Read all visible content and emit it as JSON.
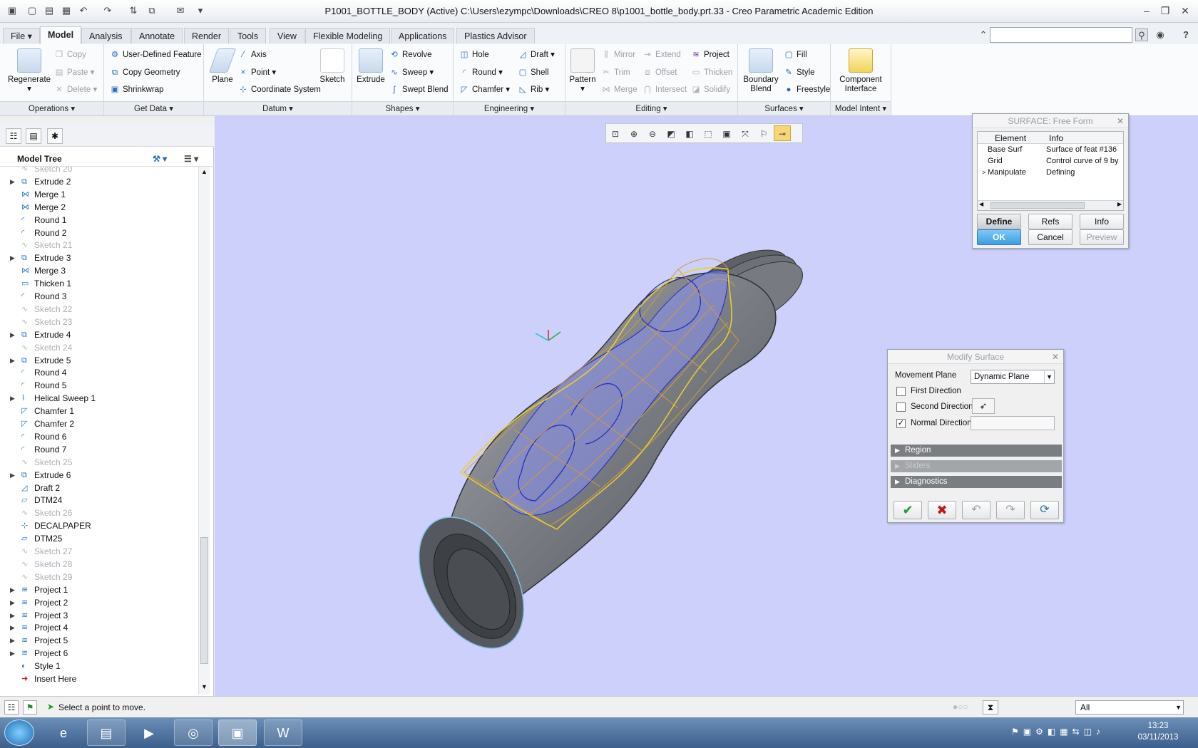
{
  "window": {
    "title": "P1001_BOTTLE_BODY (Active) C:\\Users\\ezympc\\Downloads\\CREO 8\\p1001_bottle_body.prt.33 - Creo Parametric Academic Edition"
  },
  "ribbon": {
    "tabs": [
      "File",
      "Model",
      "Analysis",
      "Annotate",
      "Render",
      "Tools",
      "View",
      "Flexible Modeling",
      "Applications",
      "Plastics Advisor"
    ],
    "active_tab": "Model",
    "groups": {
      "operations": {
        "label": "Operations",
        "regenerate": "Regenerate",
        "copy": "Copy",
        "paste": "Paste",
        "delete": "Delete"
      },
      "get_data": {
        "label": "Get Data",
        "udf": "User-Defined Feature",
        "copy_geometry": "Copy Geometry",
        "shrinkwrap": "Shrinkwrap"
      },
      "datum": {
        "label": "Datum",
        "plane": "Plane",
        "axis": "Axis",
        "point": "Point",
        "csys": "Coordinate System",
        "sketch": "Sketch"
      },
      "shapes": {
        "label": "Shapes",
        "extrude": "Extrude",
        "revolve": "Revolve",
        "sweep": "Sweep",
        "swept_blend": "Swept Blend"
      },
      "engineering": {
        "label": "Engineering",
        "hole": "Hole",
        "round": "Round",
        "chamfer": "Chamfer",
        "draft": "Draft",
        "shell": "Shell",
        "rib": "Rib"
      },
      "editing": {
        "label": "Editing",
        "pattern": "Pattern",
        "mirror": "Mirror",
        "trim": "Trim",
        "merge": "Merge",
        "extend": "Extend",
        "offset": "Offset",
        "intersect": "Intersect",
        "project": "Project",
        "thicken": "Thicken",
        "solidify": "Solidify"
      },
      "surfaces": {
        "label": "Surfaces",
        "boundary_blend": "Boundary Blend",
        "fill": "Fill",
        "style": "Style",
        "freestyle": "Freestyle"
      },
      "model_intent": {
        "label": "Model Intent",
        "component_interface": "Component Interface"
      }
    }
  },
  "model_tree": {
    "header": "Model Tree",
    "items": [
      {
        "label": "Sketch 20",
        "dim": true,
        "expandable": false,
        "icon": "sketch-icon"
      },
      {
        "label": "Extrude 2",
        "dim": false,
        "expandable": true,
        "icon": "extrude-icon"
      },
      {
        "label": "Merge 1",
        "dim": false,
        "expandable": false,
        "icon": "merge-icon"
      },
      {
        "label": "Merge 2",
        "dim": false,
        "expandable": false,
        "icon": "merge-icon"
      },
      {
        "label": "Round 1",
        "dim": false,
        "expandable": false,
        "icon": "round-icon"
      },
      {
        "label": "Round 2",
        "dim": false,
        "expandable": false,
        "icon": "round-icon"
      },
      {
        "label": "Sketch 21",
        "dim": true,
        "expandable": false,
        "icon": "sketch-icon"
      },
      {
        "label": "Extrude 3",
        "dim": false,
        "expandable": true,
        "icon": "extrude-icon"
      },
      {
        "label": "Merge 3",
        "dim": false,
        "expandable": false,
        "icon": "merge-icon"
      },
      {
        "label": "Thicken 1",
        "dim": false,
        "expandable": false,
        "icon": "thicken-icon"
      },
      {
        "label": "Round 3",
        "dim": false,
        "expandable": false,
        "icon": "round-icon"
      },
      {
        "label": "Sketch 22",
        "dim": true,
        "expandable": false,
        "icon": "sketch-icon"
      },
      {
        "label": "Sketch 23",
        "dim": true,
        "expandable": false,
        "icon": "sketch-icon"
      },
      {
        "label": "Extrude 4",
        "dim": false,
        "expandable": true,
        "icon": "extrude-icon"
      },
      {
        "label": "Sketch 24",
        "dim": true,
        "expandable": false,
        "icon": "sketch-icon"
      },
      {
        "label": "Extrude 5",
        "dim": false,
        "expandable": true,
        "icon": "extrude-icon"
      },
      {
        "label": "Round 4",
        "dim": false,
        "expandable": false,
        "icon": "round-icon"
      },
      {
        "label": "Round 5",
        "dim": false,
        "expandable": false,
        "icon": "round-icon"
      },
      {
        "label": "Helical Sweep 1",
        "dim": false,
        "expandable": true,
        "icon": "helical-sweep-icon"
      },
      {
        "label": "Chamfer 1",
        "dim": false,
        "expandable": false,
        "icon": "chamfer-icon"
      },
      {
        "label": "Chamfer 2",
        "dim": false,
        "expandable": false,
        "icon": "chamfer-icon"
      },
      {
        "label": "Round 6",
        "dim": false,
        "expandable": false,
        "icon": "round-icon"
      },
      {
        "label": "Round 7",
        "dim": false,
        "expandable": false,
        "icon": "round-icon"
      },
      {
        "label": "Sketch 25",
        "dim": true,
        "expandable": false,
        "icon": "sketch-icon"
      },
      {
        "label": "Extrude 6",
        "dim": false,
        "expandable": true,
        "icon": "extrude-icon"
      },
      {
        "label": "Draft 2",
        "dim": false,
        "expandable": false,
        "icon": "draft-icon"
      },
      {
        "label": "DTM24",
        "dim": false,
        "expandable": false,
        "icon": "datum-plane-icon"
      },
      {
        "label": "Sketch 26",
        "dim": true,
        "expandable": false,
        "icon": "sketch-icon"
      },
      {
        "label": "DECALPAPER",
        "dim": false,
        "expandable": false,
        "icon": "csys-icon"
      },
      {
        "label": "DTM25",
        "dim": false,
        "expandable": false,
        "icon": "datum-plane-icon"
      },
      {
        "label": "Sketch 27",
        "dim": true,
        "expandable": false,
        "icon": "sketch-icon"
      },
      {
        "label": "Sketch 28",
        "dim": true,
        "expandable": false,
        "icon": "sketch-icon"
      },
      {
        "label": "Sketch 29",
        "dim": true,
        "expandable": false,
        "icon": "sketch-icon"
      },
      {
        "label": "Project 1",
        "dim": false,
        "expandable": true,
        "icon": "project-icon"
      },
      {
        "label": "Project 2",
        "dim": false,
        "expandable": true,
        "icon": "project-icon"
      },
      {
        "label": "Project 3",
        "dim": false,
        "expandable": true,
        "icon": "project-icon"
      },
      {
        "label": "Project 4",
        "dim": false,
        "expandable": true,
        "icon": "project-icon"
      },
      {
        "label": "Project 5",
        "dim": false,
        "expandable": true,
        "icon": "project-icon"
      },
      {
        "label": "Project 6",
        "dim": false,
        "expandable": true,
        "icon": "project-icon"
      },
      {
        "label": "Style 1",
        "dim": false,
        "expandable": false,
        "icon": "style-icon"
      },
      {
        "label": "Insert Here",
        "dim": false,
        "expandable": false,
        "icon": "insert-arrow-icon"
      }
    ]
  },
  "surface_dialog": {
    "title": "SURFACE: Free Form",
    "columns": [
      "Element",
      "Info"
    ],
    "rows": [
      {
        "element": "Base Surf",
        "info": "Surface of feat #136"
      },
      {
        "element": "Grid",
        "info": "Control curve of 9 by"
      },
      {
        "element": "Manipulate",
        "info": "Defining"
      }
    ],
    "buttons": {
      "define": "Define",
      "refs": "Refs",
      "info": "Info",
      "ok": "OK",
      "cancel": "Cancel",
      "preview": "Preview"
    }
  },
  "modify_dialog": {
    "title": "Modify Surface",
    "movement_plane_label": "Movement Plane",
    "movement_plane_value": "Dynamic Plane",
    "first_direction": "First Direction",
    "second_direction": "Second Direction",
    "normal_direction": "Normal Direction",
    "first_checked": false,
    "second_checked": false,
    "normal_checked": true,
    "sections": [
      "Region",
      "Sliders",
      "Diagnostics"
    ]
  },
  "status": {
    "message": "Select a point to move.",
    "filter": "All"
  },
  "taskbar": {
    "time": "13:23",
    "date": "03/11/2013"
  },
  "colors": {
    "viewport_bg": "#ccd0fa",
    "grid_orange": "#d49a3c",
    "highlight_yellow": "#f0d020",
    "accent_blue": "#3d9de3"
  }
}
